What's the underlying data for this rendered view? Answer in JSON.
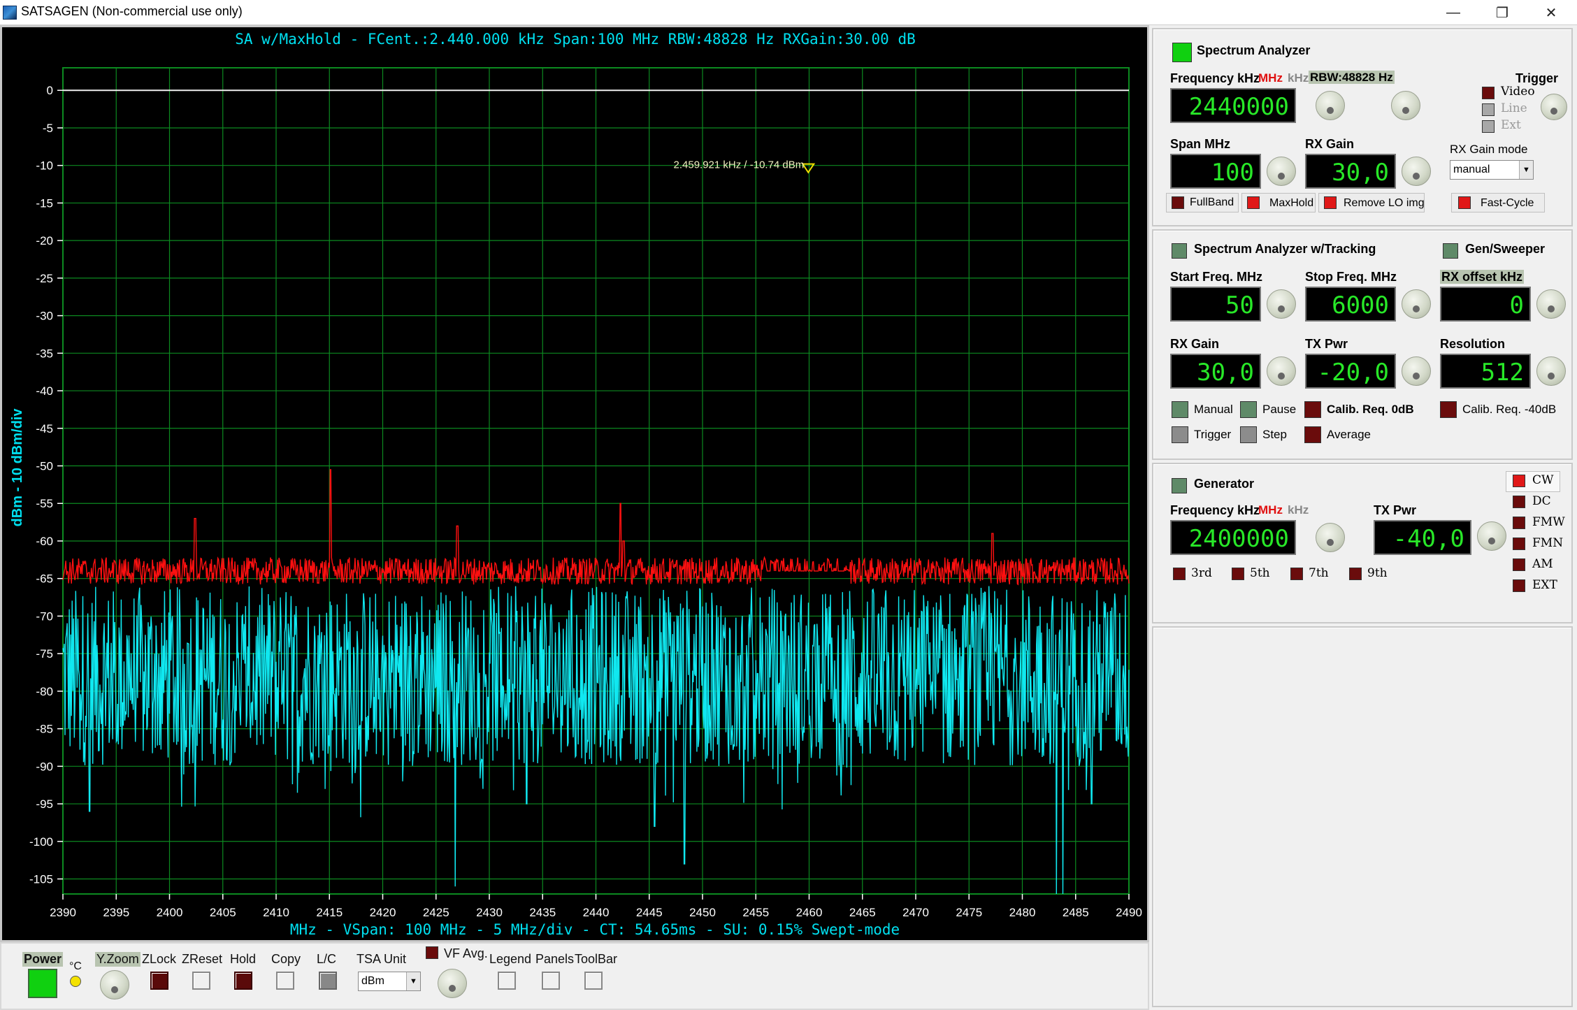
{
  "window": {
    "title": "SATSAGEN (Non-commercial use only)",
    "minimize": "—",
    "restore": "❐",
    "close": "✕"
  },
  "plot": {
    "header": "SA w/MaxHold - FCent.:2.440.000 kHz Span:100 MHz RBW:48828 Hz RXGain:30.00 dB",
    "footer": "MHz - VSpan: 100 MHz - 5 MHz/div - CT: 54.65ms - SU: 0.15% Swept-mode",
    "y_axis_label": "dBm - 10 dBm/div",
    "marker_label": "2.459.921 kHz / -10.74 dBm",
    "colors": {
      "maxhold": "#ff1010",
      "live": "#10e8f0",
      "grid": "#0c8a20",
      "text": "#00e0f0"
    }
  },
  "chart_data": {
    "type": "line",
    "x_range": [
      2390,
      2490
    ],
    "y_range": [
      -107,
      3
    ],
    "x_ticks": [
      2390,
      2395,
      2400,
      2405,
      2410,
      2415,
      2420,
      2425,
      2430,
      2435,
      2440,
      2445,
      2450,
      2455,
      2460,
      2465,
      2470,
      2475,
      2480,
      2485,
      2490
    ],
    "y_ticks": [
      0,
      -5,
      -10,
      -15,
      -20,
      -25,
      -30,
      -35,
      -40,
      -45,
      -50,
      -55,
      -60,
      -65,
      -70,
      -75,
      -80,
      -85,
      -90,
      -95,
      -100,
      -105
    ],
    "reference_line": 0,
    "marker": {
      "x": 2459.921,
      "y": -10.74
    },
    "series": [
      {
        "name": "MaxHold",
        "noise_floor": -64,
        "spurs": [
          [
            2402.4,
            -57
          ],
          [
            2415.1,
            -50.5
          ],
          [
            2427.0,
            -58
          ],
          [
            2442.3,
            -55
          ],
          [
            2477.2,
            -59
          ],
          [
            2442.6,
            -60
          ]
        ],
        "peak": {
          "x": 2459.9,
          "y": -10.7
        }
      },
      {
        "name": "Live",
        "range": [
          -90,
          -66
        ],
        "dips": [
          [
            2392.5,
            -96
          ],
          [
            2426.8,
            -106
          ],
          [
            2433.5,
            -95
          ],
          [
            2445.5,
            -98
          ],
          [
            2448.3,
            -103
          ],
          [
            2483.2,
            -107
          ],
          [
            2483.8,
            -107
          ],
          [
            2486.5,
            -95
          ]
        ]
      }
    ]
  },
  "toolbar": {
    "power": "Power",
    "celsius": "°C",
    "yzoom": "Y.Zoom",
    "zlock": "ZLock",
    "zreset": "ZReset",
    "hold": "Hold",
    "copy": "Copy",
    "lc": "L/C",
    "tsa_unit": "TSA Unit",
    "tsa_unit_value": "dBm",
    "vf_avg": "VF Avg.",
    "legend": "Legend",
    "panels": "Panels",
    "toolbar": "ToolBar"
  },
  "sa": {
    "title": "Spectrum Analyzer",
    "freq_label": "Frequency kHz",
    "mhz": "MHz",
    "khz": "kHz",
    "rbw": "RBW:48828 Hz",
    "trigger": "Trigger",
    "video": "Video",
    "line": "Line",
    "ext": "Ext",
    "freq_value": "2440000",
    "span_label": "Span MHz",
    "span_value": "100",
    "rxgain_label": "RX Gain",
    "rxgain_value": "30,0",
    "rxgain_mode_label": "RX Gain mode",
    "rxgain_mode_value": "manual",
    "fullband": "FullBand",
    "maxhold": "MaxHold",
    "remove_lo": "Remove LO img",
    "fastcycle": "Fast-Cycle"
  },
  "sat": {
    "title": "Spectrum Analyzer w/Tracking",
    "gen_sweeper": "Gen/Sweeper",
    "start_label": "Start Freq. MHz",
    "start_value": "50",
    "stop_label": "Stop Freq. MHz",
    "stop_value": "6000",
    "rxoffset_label": "RX offset kHz",
    "rxoffset_value": "0",
    "rxgain_label": "RX Gain",
    "rxgain_value": "30,0",
    "txpwr_label": "TX Pwr",
    "txpwr_value": "-20,0",
    "resolution_label": "Resolution",
    "resolution_value": "512",
    "manual": "Manual",
    "pause": "Pause",
    "calib0": "Calib. Req. 0dB",
    "calib40": "Calib. Req. -40dB",
    "trigger": "Trigger",
    "step": "Step",
    "average": "Average"
  },
  "gen": {
    "title": "Generator",
    "freq_label": "Frequency kHz",
    "mhz": "MHz",
    "khz": "kHz",
    "txpwr_label": "TX Pwr",
    "freq_value": "2400000",
    "txpwr_value": "-40,0",
    "h3": "3rd",
    "h5": "5th",
    "h7": "7th",
    "h9": "9th",
    "modes": [
      "CW",
      "DC",
      "FMW",
      "FMN",
      "AM",
      "EXT"
    ]
  }
}
